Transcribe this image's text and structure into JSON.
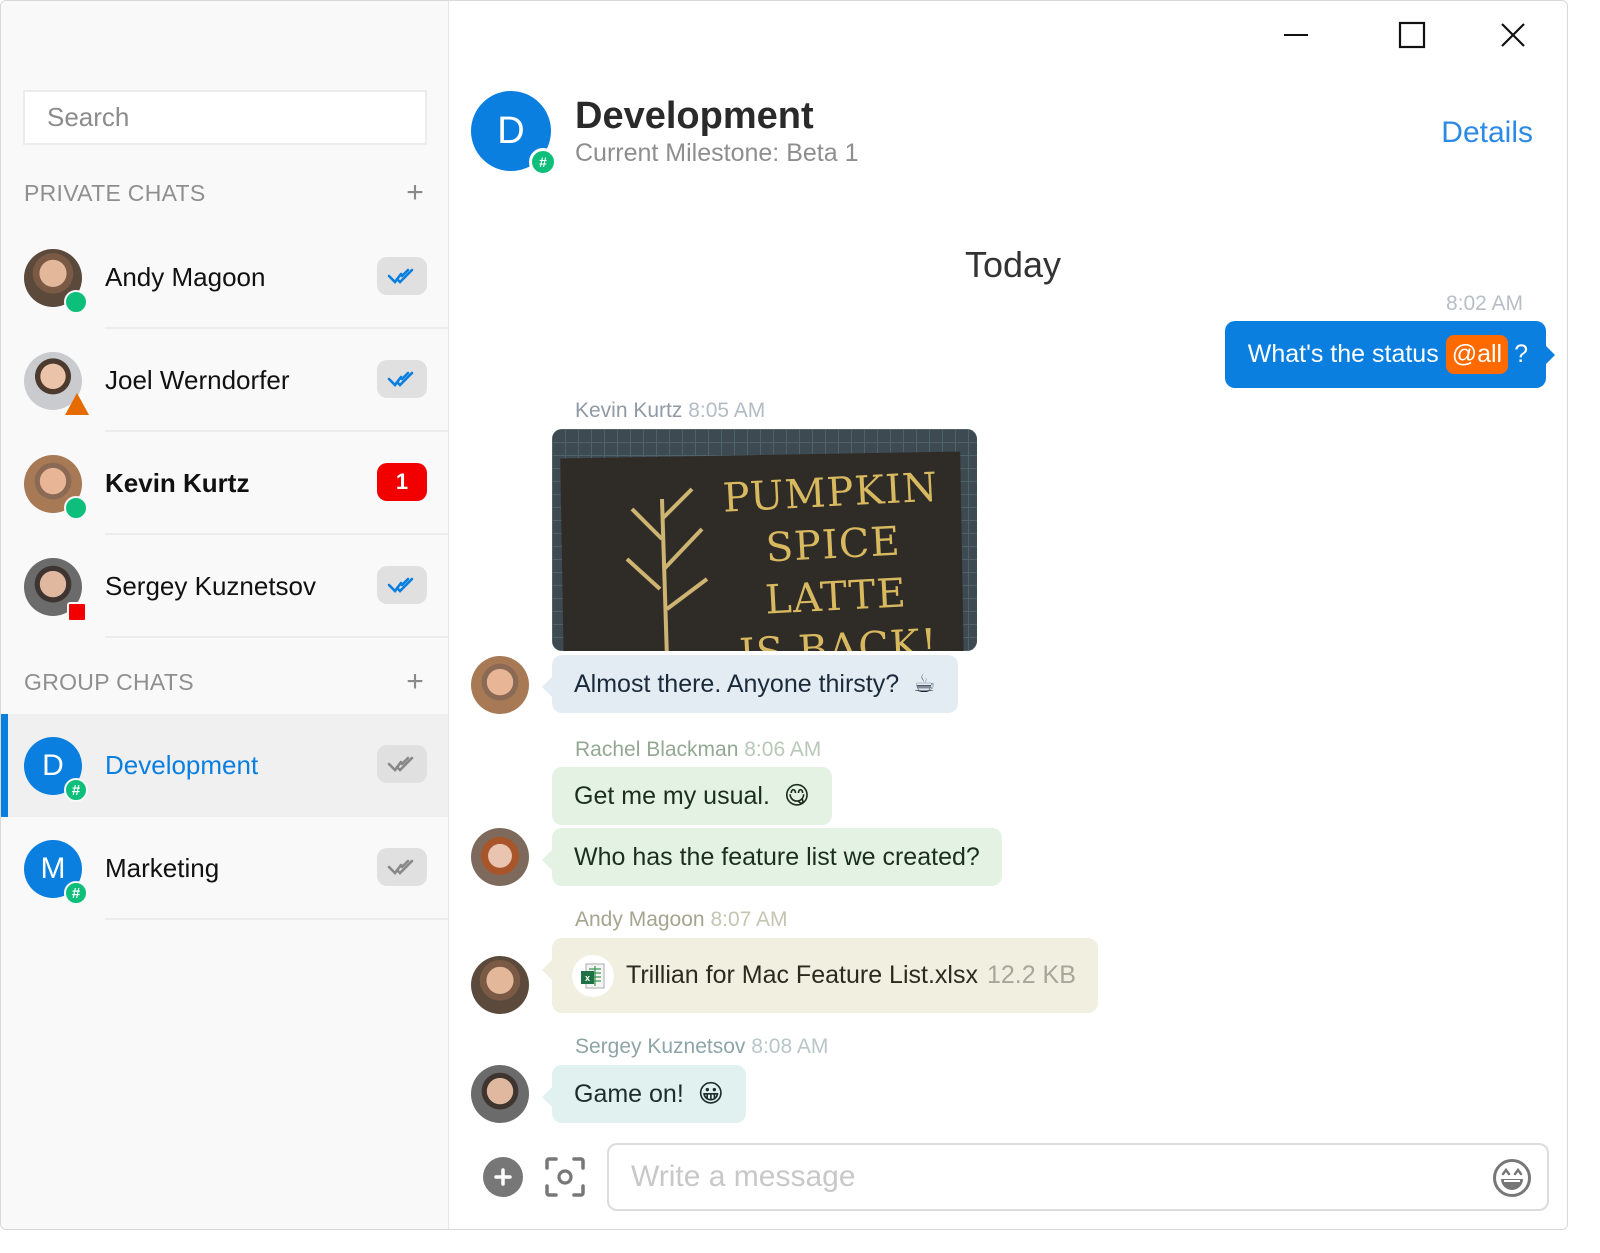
{
  "window_controls": {
    "minimize": "minimize",
    "maximize": "maximize",
    "close": "close"
  },
  "sidebar": {
    "search": {
      "placeholder": "Search",
      "value": ""
    },
    "private_section": {
      "title": "PRIVATE CHATS",
      "add_label": "+"
    },
    "private_chats": [
      {
        "name": "Andy Magoon",
        "status": "online",
        "receipt": "read",
        "unread": null
      },
      {
        "name": "Joel Werndorfer",
        "status": "away",
        "receipt": "read",
        "unread": null
      },
      {
        "name": "Kevin Kurtz",
        "status": "online",
        "receipt": null,
        "unread": "1"
      },
      {
        "name": "Sergey Kuznetsov",
        "status": "busy",
        "receipt": "read",
        "unread": null
      }
    ],
    "group_section": {
      "title": "GROUP CHATS",
      "add_label": "+"
    },
    "group_chats": [
      {
        "name": "Development",
        "initial": "D",
        "badge": "#",
        "receipt": "delivered",
        "active": true
      },
      {
        "name": "Marketing",
        "initial": "M",
        "badge": "#",
        "receipt": "delivered",
        "active": false
      }
    ]
  },
  "header": {
    "initial": "D",
    "badge": "#",
    "title": "Development",
    "subtitle": "Current Milestone: Beta 1",
    "details_label": "Details"
  },
  "conversation": {
    "day_separator": "Today",
    "outgoing": {
      "time": "8:02 AM",
      "text_before": "What's the status",
      "mention": "@all",
      "text_after": "?"
    },
    "groups": [
      {
        "sender": "Kevin Kurtz",
        "time": "8:05 AM",
        "image": {
          "caption_lines": [
            "PUMPKIN",
            "SPICE LATTE",
            "IS BACK!"
          ]
        },
        "messages": [
          {
            "text": "Almost there. Anyone thirsty?",
            "emoji": "☕"
          }
        ]
      },
      {
        "sender": "Rachel Blackman",
        "time": "8:06 AM",
        "messages": [
          {
            "text": "Get me my usual.",
            "emoji": "😋"
          },
          {
            "text": "Who has the feature list we created?",
            "emoji": null
          }
        ]
      },
      {
        "sender": "Andy Magoon",
        "time": "8:07 AM",
        "file": {
          "name": "Trillian for Mac Feature List.xlsx",
          "size": "12.2 KB",
          "icon": "excel-file-icon"
        }
      },
      {
        "sender": "Sergey Kuznetsov",
        "time": "8:08 AM",
        "messages": [
          {
            "text": "Game on!",
            "emoji": "😀"
          }
        ]
      }
    ]
  },
  "composer": {
    "placeholder": "Write a message",
    "value": ""
  },
  "colors": {
    "accent": "#0a7fe0",
    "online": "#0dbf7a",
    "away": "#e56a00",
    "busy": "#f20000",
    "mention": "#ff6a00",
    "unread_badge": "#f20000"
  }
}
